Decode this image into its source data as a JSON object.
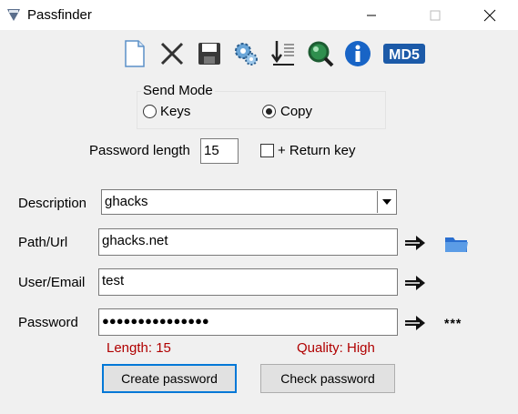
{
  "window": {
    "title": "Passfinder"
  },
  "toolbar": {
    "icons": [
      "new-document-icon",
      "delete-icon",
      "save-icon",
      "settings-gears-icon",
      "import-export-icon",
      "search-icon",
      "info-icon",
      "md5-icon"
    ],
    "md5_label": "MD5"
  },
  "send_mode": {
    "legend": "Send Mode",
    "options": [
      {
        "label": "Keys",
        "selected": false
      },
      {
        "label": "Copy",
        "selected": true
      }
    ]
  },
  "password_length": {
    "label": "Password length",
    "value": "15"
  },
  "return_key": {
    "label": "+ Return key",
    "checked": false
  },
  "fields": {
    "description": {
      "label": "Description",
      "value": "ghacks"
    },
    "path_url": {
      "label": "Path/Url",
      "value": "ghacks.net"
    },
    "user_email": {
      "label": "User/Email",
      "value": "test"
    },
    "password": {
      "label": "Password",
      "value": "●●●●●●●●●●●●●●●"
    },
    "reveal": "***"
  },
  "status": {
    "length": "Length: 15",
    "quality": "Quality: High",
    "color": "#b00000"
  },
  "buttons": {
    "create": "Create password",
    "check": "Check password"
  },
  "colors": {
    "accent": "#0078d7",
    "background": "#f0f0f0"
  }
}
